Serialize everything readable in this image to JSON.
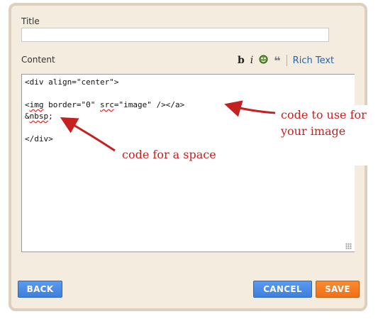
{
  "form": {
    "title_label": "Title",
    "title_value": "",
    "content_label": "Content",
    "toolbar": {
      "bold_icon": "b",
      "italic_icon": "i",
      "image_icon": "🖼",
      "quote_icon": "❝",
      "rich_text_label": "Rich Text"
    },
    "editor_lines": [
      "<div align=\"center\">",
      "",
      "<img border=\"0\" src=\"image\" /></a>",
      "&nbsp;",
      "",
      "</div>"
    ]
  },
  "annotations": {
    "image_note": "code to use for your image",
    "space_note": "code for a space",
    "color": "#c62121"
  },
  "buttons": {
    "back": "BACK",
    "cancel": "CANCEL",
    "save": "SAVE"
  }
}
